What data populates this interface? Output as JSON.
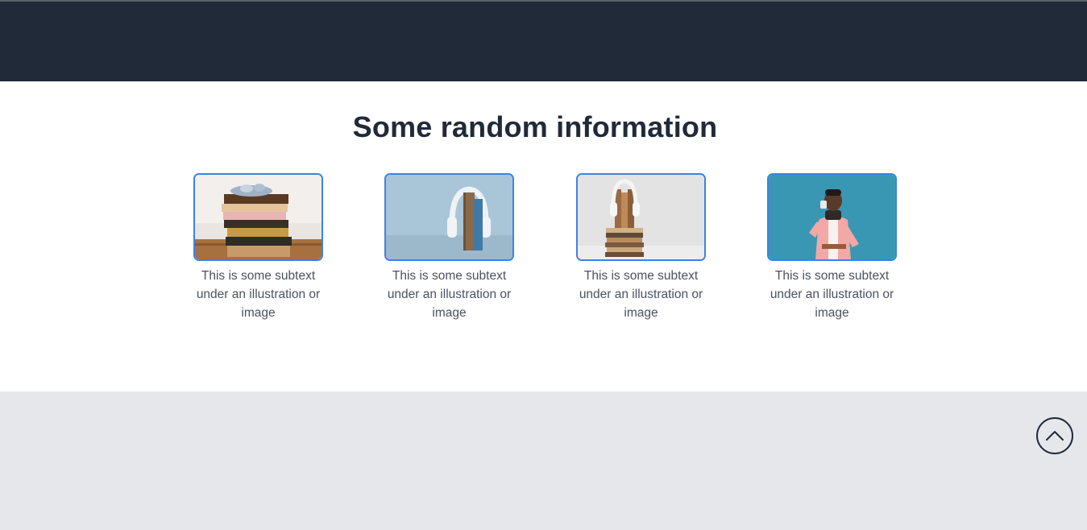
{
  "header": {},
  "section": {
    "title": "Some random information",
    "cards": [
      {
        "image": "stacked-books-photo",
        "caption": "This is some subtext under an illustration or image"
      },
      {
        "image": "headphones-book-photo",
        "caption": "This is some subtext under an illustration or image"
      },
      {
        "image": "headphones-book-stack-photo",
        "caption": "This is some subtext under an illustration or image"
      },
      {
        "image": "man-reading-photo",
        "caption": "This is some subtext under an illustration or image"
      }
    ]
  },
  "footer": {
    "scroll_top_icon": "chevron-up-icon"
  },
  "colors": {
    "header_bg": "#212a39",
    "footer_bg": "#e5e7eb",
    "card_border": "#3b82e6",
    "title": "#212a39"
  }
}
